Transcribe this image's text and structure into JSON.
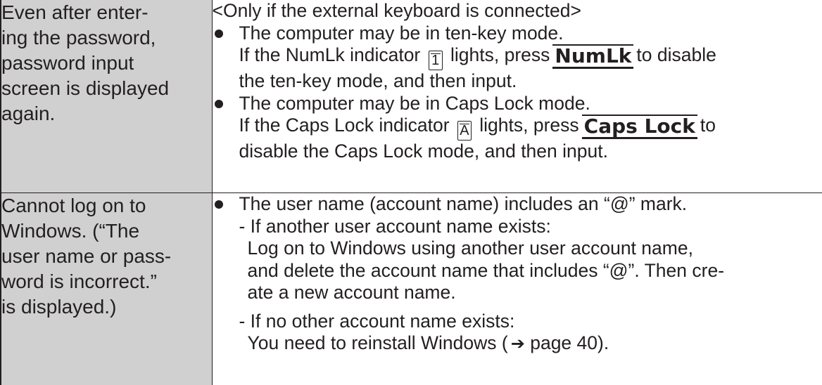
{
  "rows": [
    {
      "problem_lines": [
        "Even after enter-",
        "ing the password,",
        "password input",
        "screen is displayed",
        "again."
      ],
      "condition": "<Only if the external keyboard is connected>",
      "numlk": {
        "bullet": "The computer may be in ten-key mode.",
        "line1_pre": "If the NumLk indicator",
        "indicator_glyph": "1",
        "line1_mid": "lights, press",
        "key": "NumLk",
        "line1_post": "to disable",
        "line2": "the ten-key mode, and then input."
      },
      "caps": {
        "bullet": "The computer may be in Caps Lock mode.",
        "line1_pre": "If the Caps Lock indicator",
        "indicator_glyph": "A",
        "line1_mid": "lights, press",
        "key": "Caps Lock",
        "line1_post": "to",
        "line2": "disable the Caps Lock mode, and then input."
      }
    },
    {
      "problem_lines": [
        "Cannot log on to",
        "Windows. (“The",
        "user name or pass-",
        "word is incorrect.”",
        "is displayed.)"
      ],
      "bullet": "The user name (account name) includes an “@” mark.",
      "case1_title": "- If another user account name exists:",
      "case1_lines": [
        "Log on to Windows using another user account name,",
        "and delete the account name that includes “@”. Then cre-",
        "ate a new account name."
      ],
      "case2_title": "- If no other account name exists:",
      "case2_pre": "You need to reinstall Windows (",
      "case2_page": "page 40",
      "case2_post": ")."
    }
  ]
}
